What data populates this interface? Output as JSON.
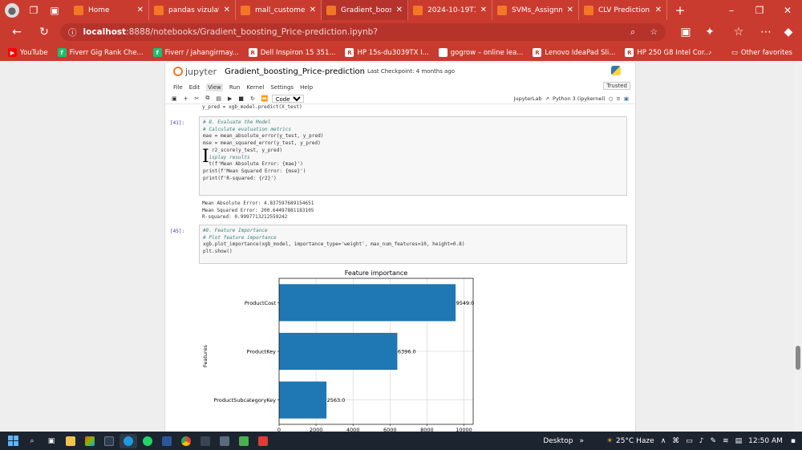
{
  "browser": {
    "tabs": [
      {
        "label": "Home",
        "active": false
      },
      {
        "label": "pandas vizulatio",
        "active": false
      },
      {
        "label": "mall_customer_",
        "active": false
      },
      {
        "label": "Gradient_boosti",
        "active": true
      },
      {
        "label": "2024-10-19T16",
        "active": false
      },
      {
        "label": "SVMs_Assignme",
        "active": false
      },
      {
        "label": "CLV Prediction",
        "active": false
      }
    ],
    "url_host": "localhost",
    "url_path": ":8888/notebooks/Gradient_boosting_Price-prediction.ipynb?",
    "bookmarks": [
      {
        "label": "YouTube",
        "icon": "youtube-icon",
        "color": "#ff0000"
      },
      {
        "label": "Fiverr Gig Rank Che...",
        "icon": "fiverr-icon",
        "color": "#1dbf73"
      },
      {
        "label": "Fiverr / jahangirmay...",
        "icon": "fiverr-icon",
        "color": "#1dbf73"
      },
      {
        "label": "Dell Inspiron 15 351...",
        "icon": "r-icon",
        "color": "#ffffff"
      },
      {
        "label": "HP 15s-du3039TX I...",
        "icon": "r-icon",
        "color": "#ffffff"
      },
      {
        "label": "gogrow – online lea...",
        "icon": "globe-icon",
        "color": "#ffffff"
      },
      {
        "label": "Lenovo IdeaPad Sli...",
        "icon": "r-icon",
        "color": "#ffffff"
      },
      {
        "label": "HP 250 G8 Intel Cor...",
        "icon": "r-icon",
        "color": "#ffffff"
      }
    ],
    "other_favorites": "Other favorites"
  },
  "jupyter": {
    "logo_text": "jupyter",
    "notebook_title": "Gradient_boosting_Price-prediction",
    "checkpoint": "Last Checkpoint: 4 months ago",
    "menu": [
      "File",
      "Edit",
      "View",
      "Run",
      "Kernel",
      "Settings",
      "Help"
    ],
    "trusted": "Trusted",
    "cell_type": "Code",
    "jupyterlab": "JupyterLab",
    "kernel": "Python 3 (ipykernel)"
  },
  "cells": {
    "top_line": "y_pred = xgb_model.predict(X_test)",
    "cell1_prompt": "[41]:",
    "cell1_lines": [
      "# 8. Evaluate the Model",
      "# Calculate evaluation metrics",
      "mae = mean_absolute_error(y_test, y_pred)",
      "mse = mean_squared_error(y_test, y_pred)",
      "   r2_score(y_test, y_pred)",
      "",
      "  isplay results",
      "  t(f'Mean Absolute Error: {mae}')",
      "print(f'Mean Squared Error: {mse}')",
      "print(f'R-squared: {r2}')"
    ],
    "cell1_output": [
      "Mean Absolute Error: 4.837597689154651",
      "Mean Squared Error: 200.64497881183105",
      "R-squared: 0.9997713212559242"
    ],
    "cell2_prompt": "[45]:",
    "cell2_lines": [
      "#9. Feature Importance",
      "# Plot feature importance",
      "xgb.plot_importance(xgb_model, importance_type='weight', max_num_features=10, height=0.8)",
      "plt.show()"
    ]
  },
  "chart_data": {
    "type": "bar",
    "orientation": "horizontal",
    "title": "Feature importance",
    "ylabel": "Features",
    "xlabel": "",
    "categories": [
      "ProductCost",
      "ProductKey",
      "ProductSubcategoryKey"
    ],
    "values": [
      9549.0,
      6396.0,
      2563.0
    ],
    "value_labels": [
      "9549.0",
      "6396.0",
      "2563.0"
    ],
    "xlim": [
      0,
      10500
    ],
    "xticks": [
      0,
      2000,
      4000,
      6000,
      8000,
      10000
    ],
    "grid": true,
    "bar_color": "#1f77b4"
  },
  "taskbar": {
    "desktop": "Desktop",
    "weather": "25°C Haze",
    "time": "12:50 AM"
  }
}
